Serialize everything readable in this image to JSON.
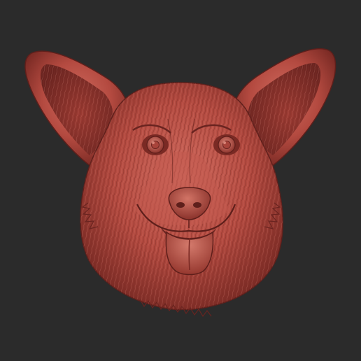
{
  "scene": {
    "subject": "dog-head-relief",
    "background_color": "#2b2b2b",
    "material_color": "#b44a40",
    "material_shadow": "#6a2420",
    "material_highlight": "#d8786a"
  }
}
